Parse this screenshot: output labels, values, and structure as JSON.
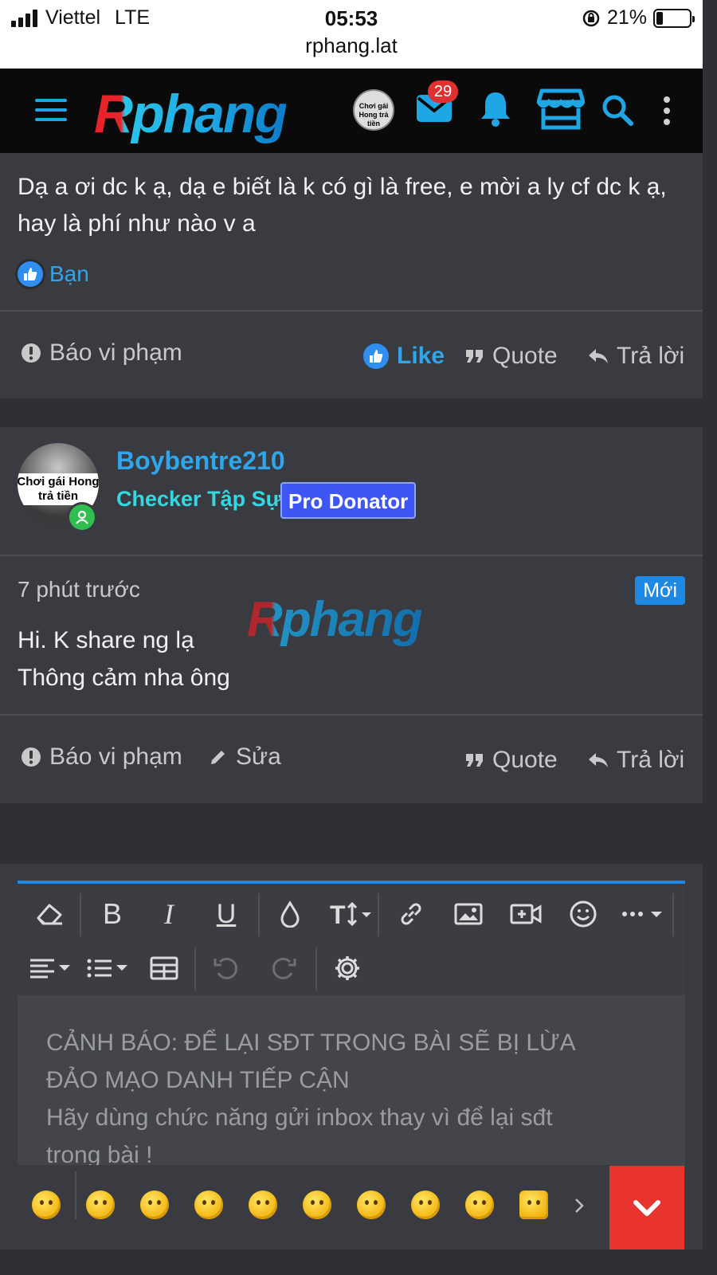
{
  "status_bar": {
    "carrier": "Viettel",
    "network": "LTE",
    "time": "05:53",
    "url": "rphang.lat",
    "battery_percent": "21%",
    "battery_level": 0.21
  },
  "header": {
    "logo_text": "Rphang",
    "avatar_caption": "Chơi gái Hong trả tiền",
    "inbox_count": "29",
    "icons": [
      "menu-icon",
      "mail-icon",
      "bell-icon",
      "store-icon",
      "search-icon",
      "more-vertical-icon"
    ]
  },
  "post1": {
    "body": "Dạ a ơi dc k ạ, dạ e biết là k có gì là free, e mời a ly cf dc k ạ, hay là phí như nào v a",
    "reaction_label": "Bạn",
    "report_label": "Báo vi phạm",
    "like_label": "Like",
    "quote_label": "Quote",
    "reply_label": "Trả lời"
  },
  "post2": {
    "username": "Boybentre210",
    "avatar_caption": "Chơi gái Hong trả tiền",
    "user_title": "Checker Tập Sự",
    "badge": "Pro Donator",
    "time": "7 phút trước",
    "new_label": "Mới",
    "watermark": "Rphang",
    "body_line1": "Hi. K share ng lạ",
    "body_line2": "Thông cảm nha ông",
    "report_label": "Báo vi phạm",
    "edit_label": "Sửa",
    "quote_label": "Quote",
    "reply_label": "Trả lời"
  },
  "editor": {
    "placeholder_line1": "CẢNH BÁO: ĐỂ LẠI SĐT TRONG BÀI SẼ BỊ LỪA",
    "placeholder_line2": "ĐẢO MẠO DANH TIẾP CẬN",
    "placeholder_line3": "Hãy dùng chức năng gửi inbox thay vì để lại sđt",
    "placeholder_line4": "trong bài !",
    "toolbar": [
      "eraser-icon",
      "bold-icon",
      "italic-icon",
      "underline-icon",
      "color-icon",
      "font-size-icon",
      "link-icon",
      "image-icon",
      "video-icon",
      "smiley-icon",
      "more-icon",
      "align-icon",
      "list-icon",
      "table-icon",
      "undo-icon",
      "redo-icon",
      "settings-icon"
    ],
    "bold_glyph": "B",
    "italic_glyph": "I",
    "underline_glyph": "U"
  }
}
